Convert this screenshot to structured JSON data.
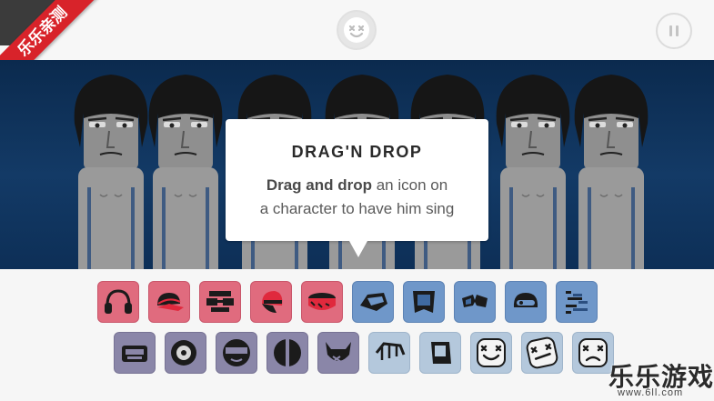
{
  "corner_badge": "乐乐亲测",
  "tooltip": {
    "title": "DRAG'N DROP",
    "body_bold": "Drag and drop",
    "body_rest_1": " an icon on",
    "body_line_2": "a character to have him sing"
  },
  "watermark": {
    "text": "乐乐游戏",
    "url": "www.6ll.com"
  },
  "palette_row1": [
    {
      "icon": "headphones-icon",
      "color": "red"
    },
    {
      "icon": "cap-icon",
      "color": "red"
    },
    {
      "icon": "glasses-headband-icon",
      "color": "red"
    },
    {
      "icon": "sideways-cap-icon",
      "color": "red"
    },
    {
      "icon": "drum-hat-icon",
      "color": "red"
    },
    {
      "icon": "visor-icon",
      "color": "blue"
    },
    {
      "icon": "square-badge-icon",
      "color": "blue"
    },
    {
      "icon": "shades-icon",
      "color": "blue"
    },
    {
      "icon": "helmet-icon",
      "color": "blue"
    },
    {
      "icon": "pixel-noise-icon",
      "color": "blue"
    }
  ],
  "palette_row2": [
    {
      "icon": "robot-mask-icon",
      "color": "purple"
    },
    {
      "icon": "speaker-icon",
      "color": "purple"
    },
    {
      "icon": "sunglasses-face-icon",
      "color": "purple"
    },
    {
      "icon": "split-orb-icon",
      "color": "purple"
    },
    {
      "icon": "horned-mask-icon",
      "color": "purple"
    },
    {
      "icon": "cage-icon",
      "color": "lightblue"
    },
    {
      "icon": "card-icon",
      "color": "lightblue"
    },
    {
      "icon": "marshmello-icon",
      "color": "lightblue"
    },
    {
      "icon": "marshmello-tilt-icon",
      "color": "lightblue"
    },
    {
      "icon": "marshmello-x-icon",
      "color": "lightblue"
    }
  ]
}
